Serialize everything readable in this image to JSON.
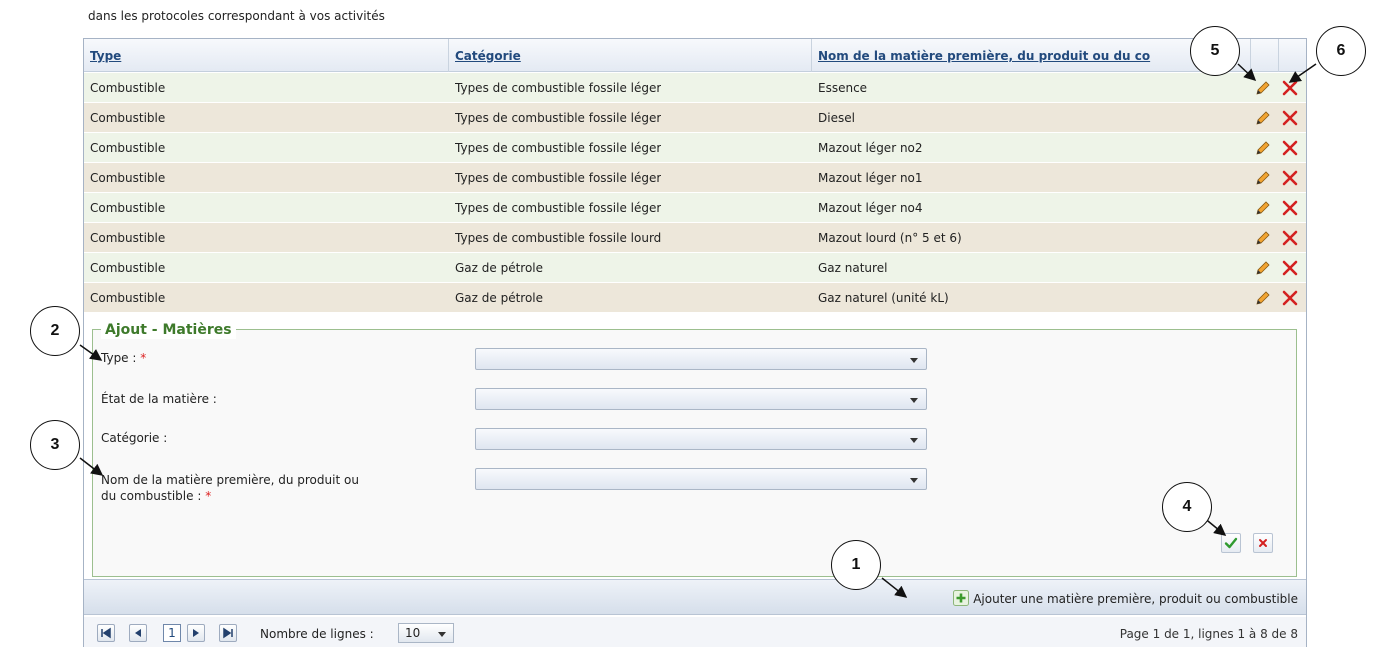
{
  "intro": {
    "line1": "dans les protocoles correspondant à vos activités"
  },
  "table": {
    "columns": [
      "Type",
      "Catégorie",
      "Nom de la matière première, du produit ou du co"
    ],
    "rows": [
      {
        "type": "Combustible",
        "categorie": "Types de combustible fossile léger",
        "nom": "Essence"
      },
      {
        "type": "Combustible",
        "categorie": "Types de combustible fossile léger",
        "nom": "Diesel"
      },
      {
        "type": "Combustible",
        "categorie": "Types de combustible fossile léger",
        "nom": "Mazout léger no2"
      },
      {
        "type": "Combustible",
        "categorie": "Types de combustible fossile léger",
        "nom": "Mazout léger no1"
      },
      {
        "type": "Combustible",
        "categorie": "Types de combustible fossile léger",
        "nom": "Mazout léger no4"
      },
      {
        "type": "Combustible",
        "categorie": "Types de combustible fossile lourd",
        "nom": "Mazout lourd (n° 5 et 6)"
      },
      {
        "type": "Combustible",
        "categorie": "Gaz de pétrole",
        "nom": "Gaz naturel"
      },
      {
        "type": "Combustible",
        "categorie": "Gaz de pétrole",
        "nom": "Gaz naturel (unité kL)"
      }
    ]
  },
  "form": {
    "legend": "Ajout - Matières",
    "fields": [
      {
        "label": "Type :",
        "required": "*",
        "value": ""
      },
      {
        "label": "État de la matière :",
        "required": "",
        "value": ""
      },
      {
        "label": "Catégorie :",
        "required": "",
        "value": ""
      },
      {
        "label_line1": "Nom de la matière première, du produit ou",
        "label_line2": "du combustible :",
        "required": "*",
        "value": ""
      }
    ]
  },
  "addbar": {
    "link_label": "Ajouter une matière première, produit ou combustible"
  },
  "pager": {
    "current_page": "1",
    "rows_label": "Nombre de lignes :",
    "rows_value": "10",
    "info": "Page 1 de 1, lignes 1 à 8 de 8"
  },
  "callouts": [
    "1",
    "2",
    "3",
    "4",
    "5",
    "6"
  ],
  "icons": {
    "edit": "pencil-icon",
    "delete": "delete-x-icon",
    "confirm": "checkmark-icon",
    "cancel": "cancel-x-icon",
    "add": "plus-icon"
  },
  "colors": {
    "header_link": "#224a7d",
    "row_odd": "#eef4e8",
    "row_even": "#ede7da",
    "legend": "#3e7a2b",
    "required": "#dd2222",
    "delete": "#d32020",
    "confirm": "#2f9a2f"
  }
}
